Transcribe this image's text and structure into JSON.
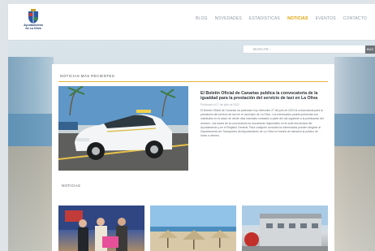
{
  "header": {
    "logo_text_line1": "Ayuntamiento",
    "logo_text_line2": "de La Oliva",
    "nav": [
      {
        "label": "BLOG",
        "active": false
      },
      {
        "label": "NOVEDADES",
        "active": false
      },
      {
        "label": "ESTADÍSTICAS",
        "active": false
      },
      {
        "label": "NOTICIAS",
        "active": true
      },
      {
        "label": "EVENTOS",
        "active": false
      },
      {
        "label": "CONTACTO",
        "active": false
      }
    ]
  },
  "search": {
    "placeholder": "BUSCAR...",
    "button_label": "BUS"
  },
  "featured": {
    "section_title": "NOTICIAS MÁS RECIENTES",
    "title": "El Boletín Oficial de Canarias publica la convocatoria de la igualdad para la prestación del servicio de taxi en La Oliva",
    "date": "Publicado el 27 de julio de 2022",
    "body": "El Boletín Oficial de Canarias ha publicado hoy miércoles 27 de julio de 2022 la convocatoria para la prestación del servicio de taxi en el municipio de La Oliva. Los interesados podrán presentar sus solicitudes en el plazo de veinte días naturales contados a partir del día siguiente a la publicación del anuncio. Las bases de la convocatoria se encuentran disponibles en la sede electrónica del Ayuntamiento y en el Registro General. Para cualquier consulta los interesados pueden dirigirse al Departamento de Transportes del Ayuntamiento de La Oliva en horario de atención al público de lunes a viernes."
  },
  "news": {
    "section_title": "NOTICIAS"
  },
  "colors": {
    "accent": "#e0a100",
    "nav_text": "#8f99a3",
    "title_text": "#2e3338"
  }
}
